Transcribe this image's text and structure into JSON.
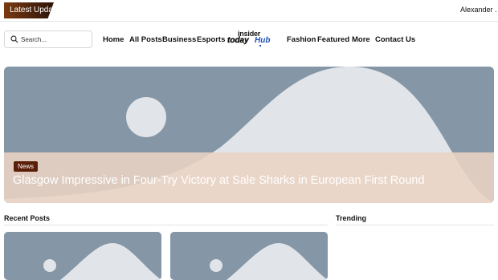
{
  "topbar": {
    "latest_label": "Latest Update",
    "ticker_text": "Alexander ."
  },
  "search": {
    "placeholder": "Search..."
  },
  "nav": {
    "left": [
      "Home",
      "All Posts",
      "Business",
      "Esports"
    ],
    "right": [
      "Fashion",
      "Featured",
      "More",
      "Contact Us"
    ]
  },
  "logo": {
    "line1": "insider",
    "line2a": "today",
    "line2b": "Hub"
  },
  "hero": {
    "tag": "News",
    "title": "Glasgow Impressive in Four-Try Victory at Sale Sharks in European First Round"
  },
  "sections": {
    "recent": "Recent Posts",
    "trending": "Trending"
  },
  "colors": {
    "placeholder_bg": "#8596a6",
    "placeholder_shape": "#e1e4e8",
    "overlay": "#ead4c4",
    "tag_bg": "#5a1e08",
    "logo_accent": "#1d4fb8"
  }
}
